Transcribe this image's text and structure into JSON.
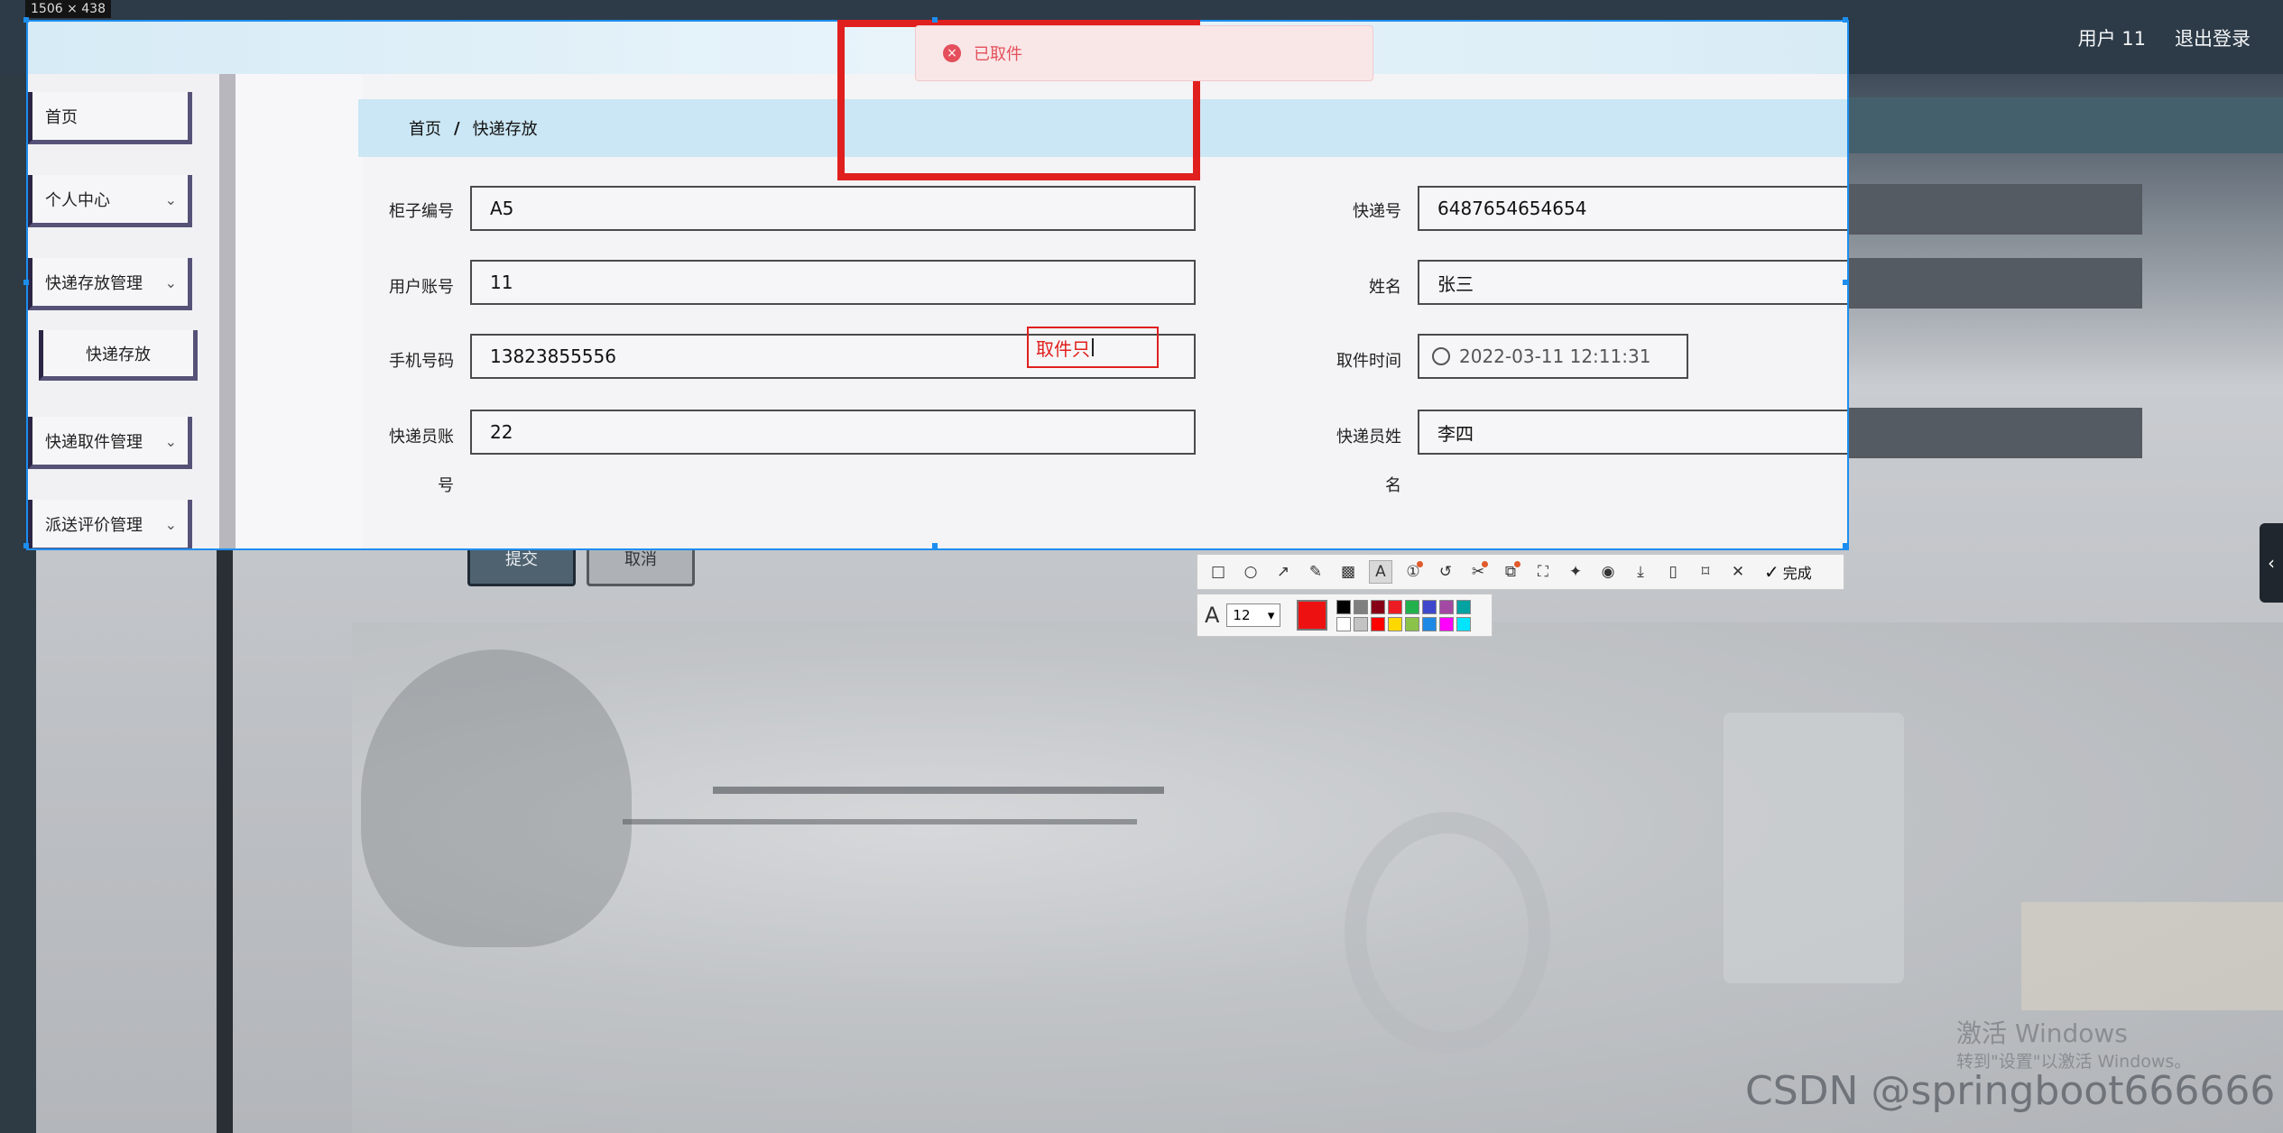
{
  "app": {
    "user_label": "用户 11",
    "logout_label": "退出登录",
    "submit_label": "提交",
    "cancel_label": "取消",
    "panel_toggle_label": "‹"
  },
  "screenshot": {
    "size_badge": "1506 × 438"
  },
  "toast": {
    "icon": "x-circle-icon",
    "message": "已取件"
  },
  "sidebar": {
    "items": [
      {
        "label": "首页",
        "has_chevron": false
      },
      {
        "label": "个人中心",
        "has_chevron": true
      },
      {
        "label": "快递存放管理",
        "has_chevron": true
      },
      {
        "label": "快递存放",
        "has_chevron": false
      },
      {
        "label": "快递取件管理",
        "has_chevron": true
      },
      {
        "label": "派送评价管理",
        "has_chevron": true
      }
    ],
    "chevron": "⌄"
  },
  "breadcrumb": {
    "home": "首页",
    "separator": "/",
    "current": "快递存放"
  },
  "form": {
    "cabinet_no": {
      "label": "柜子编号",
      "value": "A5"
    },
    "express_no": {
      "label": "快递号",
      "value": "6487654654654"
    },
    "user_account": {
      "label": "用户账号",
      "value": "11"
    },
    "name": {
      "label": "姓名",
      "value": "张三"
    },
    "phone": {
      "label": "手机号码",
      "value": "13823855556"
    },
    "pickup_time": {
      "label": "取件时间",
      "value": "2022-03-11 12:11:31"
    },
    "courier_account": {
      "label_line1": "快递员账",
      "label_line2": "号",
      "value": "22"
    },
    "courier_name": {
      "label_line1": "快递员姓",
      "label_line2": "名",
      "value": "李四"
    }
  },
  "annotation": {
    "text": "取件只"
  },
  "toolbar": {
    "tools": [
      "rectangle-icon",
      "ellipse-icon",
      "arrow-icon",
      "pencil-icon",
      "mosaic-icon",
      "text-icon",
      "number-marker-icon",
      "undo-icon",
      "scissors-icon",
      "copy-icon",
      "screen-capture-icon",
      "pin-icon",
      "record-icon",
      "download-icon",
      "save-icon",
      "bookmark-icon",
      "close-icon"
    ],
    "done_label": "完成",
    "font_size": "12",
    "current_color": "#ee1111",
    "palette": [
      "#000000",
      "#7f7f7f",
      "#880015",
      "#ed1c24",
      "#22b14c",
      "#3f48cc",
      "#a349a4",
      "#00a2a2",
      "#ffffff",
      "#c3c3c3",
      "#ff0000",
      "#ffd800",
      "#8bc34a",
      "#1e88e5",
      "#ff00ff",
      "#00e5ff"
    ]
  },
  "watermarks": {
    "windows_title": "激活 Windows",
    "windows_sub": "转到\"设置\"以激活 Windows。",
    "csdn": "CSDN @springboot666666"
  }
}
